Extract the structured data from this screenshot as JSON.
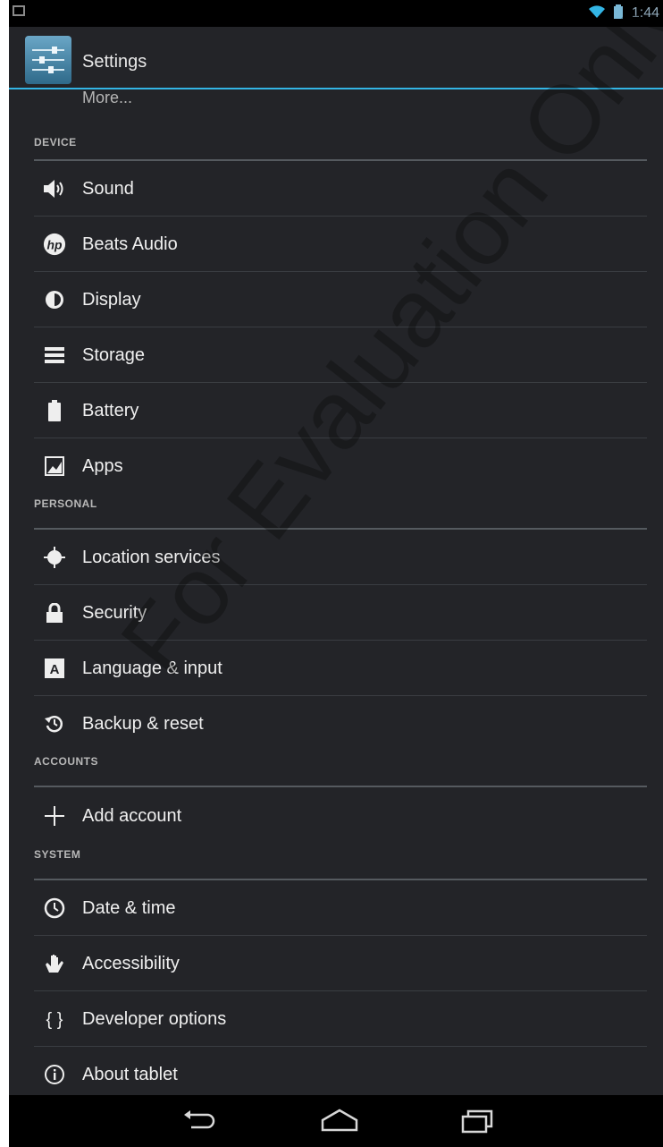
{
  "status_bar": {
    "clock": "1:44"
  },
  "action_bar": {
    "title": "Settings"
  },
  "more_label": "More...",
  "sections": [
    {
      "header": "DEVICE",
      "items": [
        {
          "label": "Sound",
          "icon": "speaker-icon"
        },
        {
          "label": "Beats Audio",
          "icon": "hp-logo-icon"
        },
        {
          "label": "Display",
          "icon": "brightness-icon"
        },
        {
          "label": "Storage",
          "icon": "storage-icon"
        },
        {
          "label": "Battery",
          "icon": "battery-icon"
        },
        {
          "label": "Apps",
          "icon": "apps-icon"
        }
      ]
    },
    {
      "header": "PERSONAL",
      "items": [
        {
          "label": "Location services",
          "icon": "location-icon"
        },
        {
          "label": "Security",
          "icon": "lock-icon"
        },
        {
          "label": "Language & input",
          "icon": "keyboard-a-icon"
        },
        {
          "label": "Backup & reset",
          "icon": "backup-icon"
        }
      ]
    },
    {
      "header": "ACCOUNTS",
      "items": [
        {
          "label": "Add account",
          "icon": "plus-icon"
        }
      ]
    },
    {
      "header": "SYSTEM",
      "items": [
        {
          "label": "Date & time",
          "icon": "clock-icon"
        },
        {
          "label": "Accessibility",
          "icon": "hand-icon"
        },
        {
          "label": "Developer options",
          "icon": "braces-icon"
        },
        {
          "label": "About tablet",
          "icon": "info-icon"
        }
      ]
    }
  ],
  "watermark": "For Evaluation Only",
  "colors": {
    "background": "#232428",
    "accent": "#33b5e5",
    "text": "#f0f0f0",
    "section_text": "#b8b8b8",
    "divider": "#555a5f",
    "navbar": "#000000"
  },
  "nav_bar": [
    "back-icon",
    "home-icon",
    "recent-apps-icon"
  ]
}
